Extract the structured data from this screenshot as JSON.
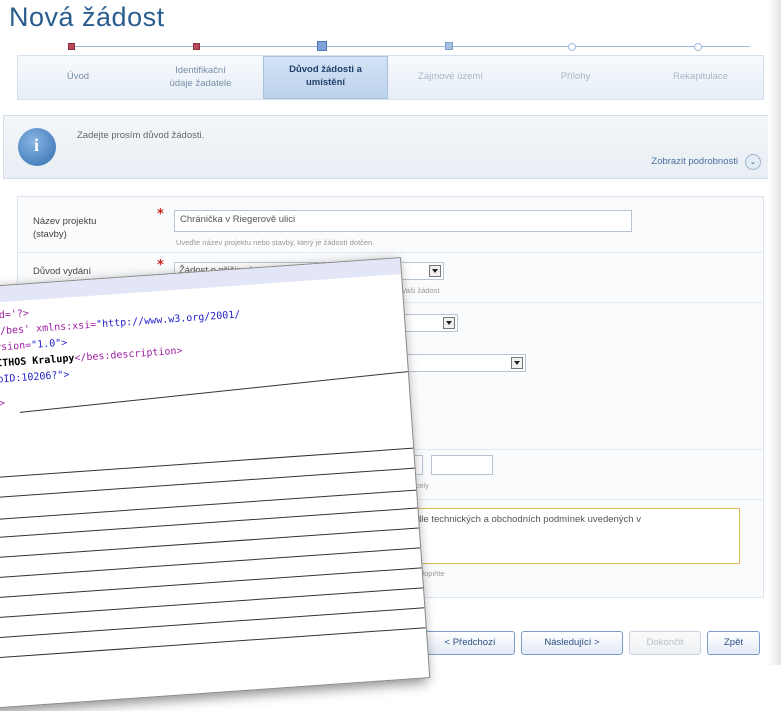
{
  "page_title": "Nová žádost",
  "steps": [
    {
      "label_line1": "Úvod",
      "label_line2": "",
      "state": "done"
    },
    {
      "label_line1": "Identifikační",
      "label_line2": "údaje žadatele",
      "state": "done"
    },
    {
      "label_line1": "Důvod žádosti a",
      "label_line2": "umístění",
      "state": "current"
    },
    {
      "label_line1": "Zájmové území",
      "label_line2": "",
      "state": "future"
    },
    {
      "label_line1": "Přílohy",
      "label_line2": "",
      "state": "future"
    },
    {
      "label_line1": "Rekapitulace",
      "label_line2": "",
      "state": "future"
    }
  ],
  "info": {
    "text": "Zadejte prosím důvod žádosti.",
    "detail_link": "Zobrazit podrobnosti"
  },
  "form": {
    "project_name": {
      "label_line1": "Název projektu",
      "label_line2": "(stavby)",
      "value": "Chránička v Riegerově ulici",
      "hint": "Uveďte název projektu nebo stavby, který je žádostí dotčen."
    },
    "reason": {
      "label": "Důvod vydání",
      "value": "Žádost o příčinu k povolení infrastruktury",
      "hint": "...vte Vaši žádost"
    },
    "parcel_hint": "...tislo parcely",
    "note_text": "...ajdete podle technických a obchodních podmínek uvedených v",
    "note_hint": "...k žádosti dopiňte"
  },
  "buttons": {
    "prev": "< Předchozí",
    "next": "Následující >",
    "finish": "Dokončit",
    "back": "Zpět"
  },
  "xml_overlay": {
    "line1": "ad='?>",
    "line2_a": "m/bes' xmlns:xsi=",
    "line2_b": "\"http://www.w3.org/2001/",
    "line3_a": "rsion=",
    "line3_b": "\"1.0\">",
    "line4_a": "ITHOS Kralupy",
    "line4_b": "</bes:description>",
    "line5_a": "pID:10206?\">",
    "line6": ">"
  }
}
